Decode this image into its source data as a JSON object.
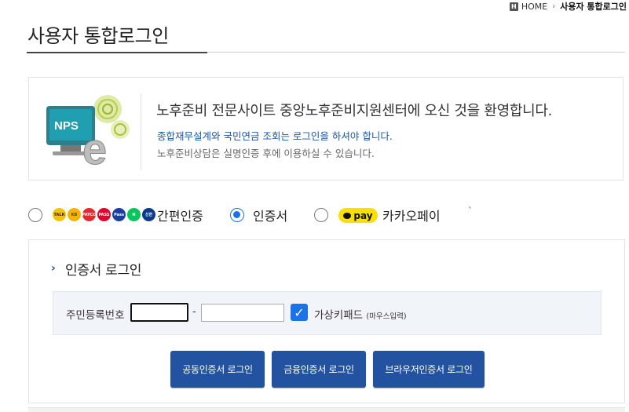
{
  "breadcrumb": {
    "home_icon": "H",
    "home": "HOME",
    "separator": "›",
    "current": "사용자 통합로그인"
  },
  "page_title": "사용자 통합로그인",
  "welcome": {
    "logo_text": "NPS",
    "logo_e": "e",
    "main": "노후준비 전문사이트 중앙노후준비지원센터에 오신 것을 환영합니다.",
    "sub1": "종합재무설계와 국민연금 조회는 로그인을 하셔야 합니다.",
    "sub2": "노후준비상담은 실명인증 후에 이용하실 수 있습니다."
  },
  "auth_options": {
    "selected": "인증서",
    "simple": {
      "label": "간편인증",
      "providers": [
        {
          "name": "kakao-talk",
          "text": "TALK",
          "color": "#f2c500",
          "fg": "#3a1d1d"
        },
        {
          "name": "kb",
          "text": "KB",
          "color": "#f5b400",
          "fg": "#5a4300"
        },
        {
          "name": "payco",
          "text": "PAYCO",
          "color": "#e8272f",
          "fg": "#ffffff"
        },
        {
          "name": "pass",
          "text": "PASS",
          "color": "#e4002b",
          "fg": "#ffffff"
        },
        {
          "name": "samsung-pass",
          "text": "Pass",
          "color": "#1a3fa0",
          "fg": "#ffffff"
        },
        {
          "name": "naver",
          "text": "N",
          "color": "#03c75a",
          "fg": "#ffffff"
        },
        {
          "name": "shinhan",
          "text": "신한",
          "color": "#0b3a8c",
          "fg": "#ffffff"
        }
      ]
    },
    "certificate": {
      "label": "인증서"
    },
    "kakaopay": {
      "label": "카카오페이",
      "badge": "pay"
    },
    "stray_mark": "`"
  },
  "login": {
    "chevron": "›",
    "title": "인증서 로그인",
    "ssn_label": "주민등록번호",
    "ssn_front": "",
    "ssn_dash": "-",
    "ssn_back": "",
    "virtual_keypad_checked": true,
    "virtual_keypad_label": "가상키패드",
    "virtual_keypad_note": "(마우스입력)",
    "buttons": [
      "공동인증서 로그인",
      "금융인증서 로그인",
      "브라우저인증서 로그인"
    ]
  },
  "colors": {
    "accent": "#1a73e8",
    "button": "#2352a0",
    "link_text": "#1a56a8",
    "kakao_yellow": "#f9e000"
  }
}
